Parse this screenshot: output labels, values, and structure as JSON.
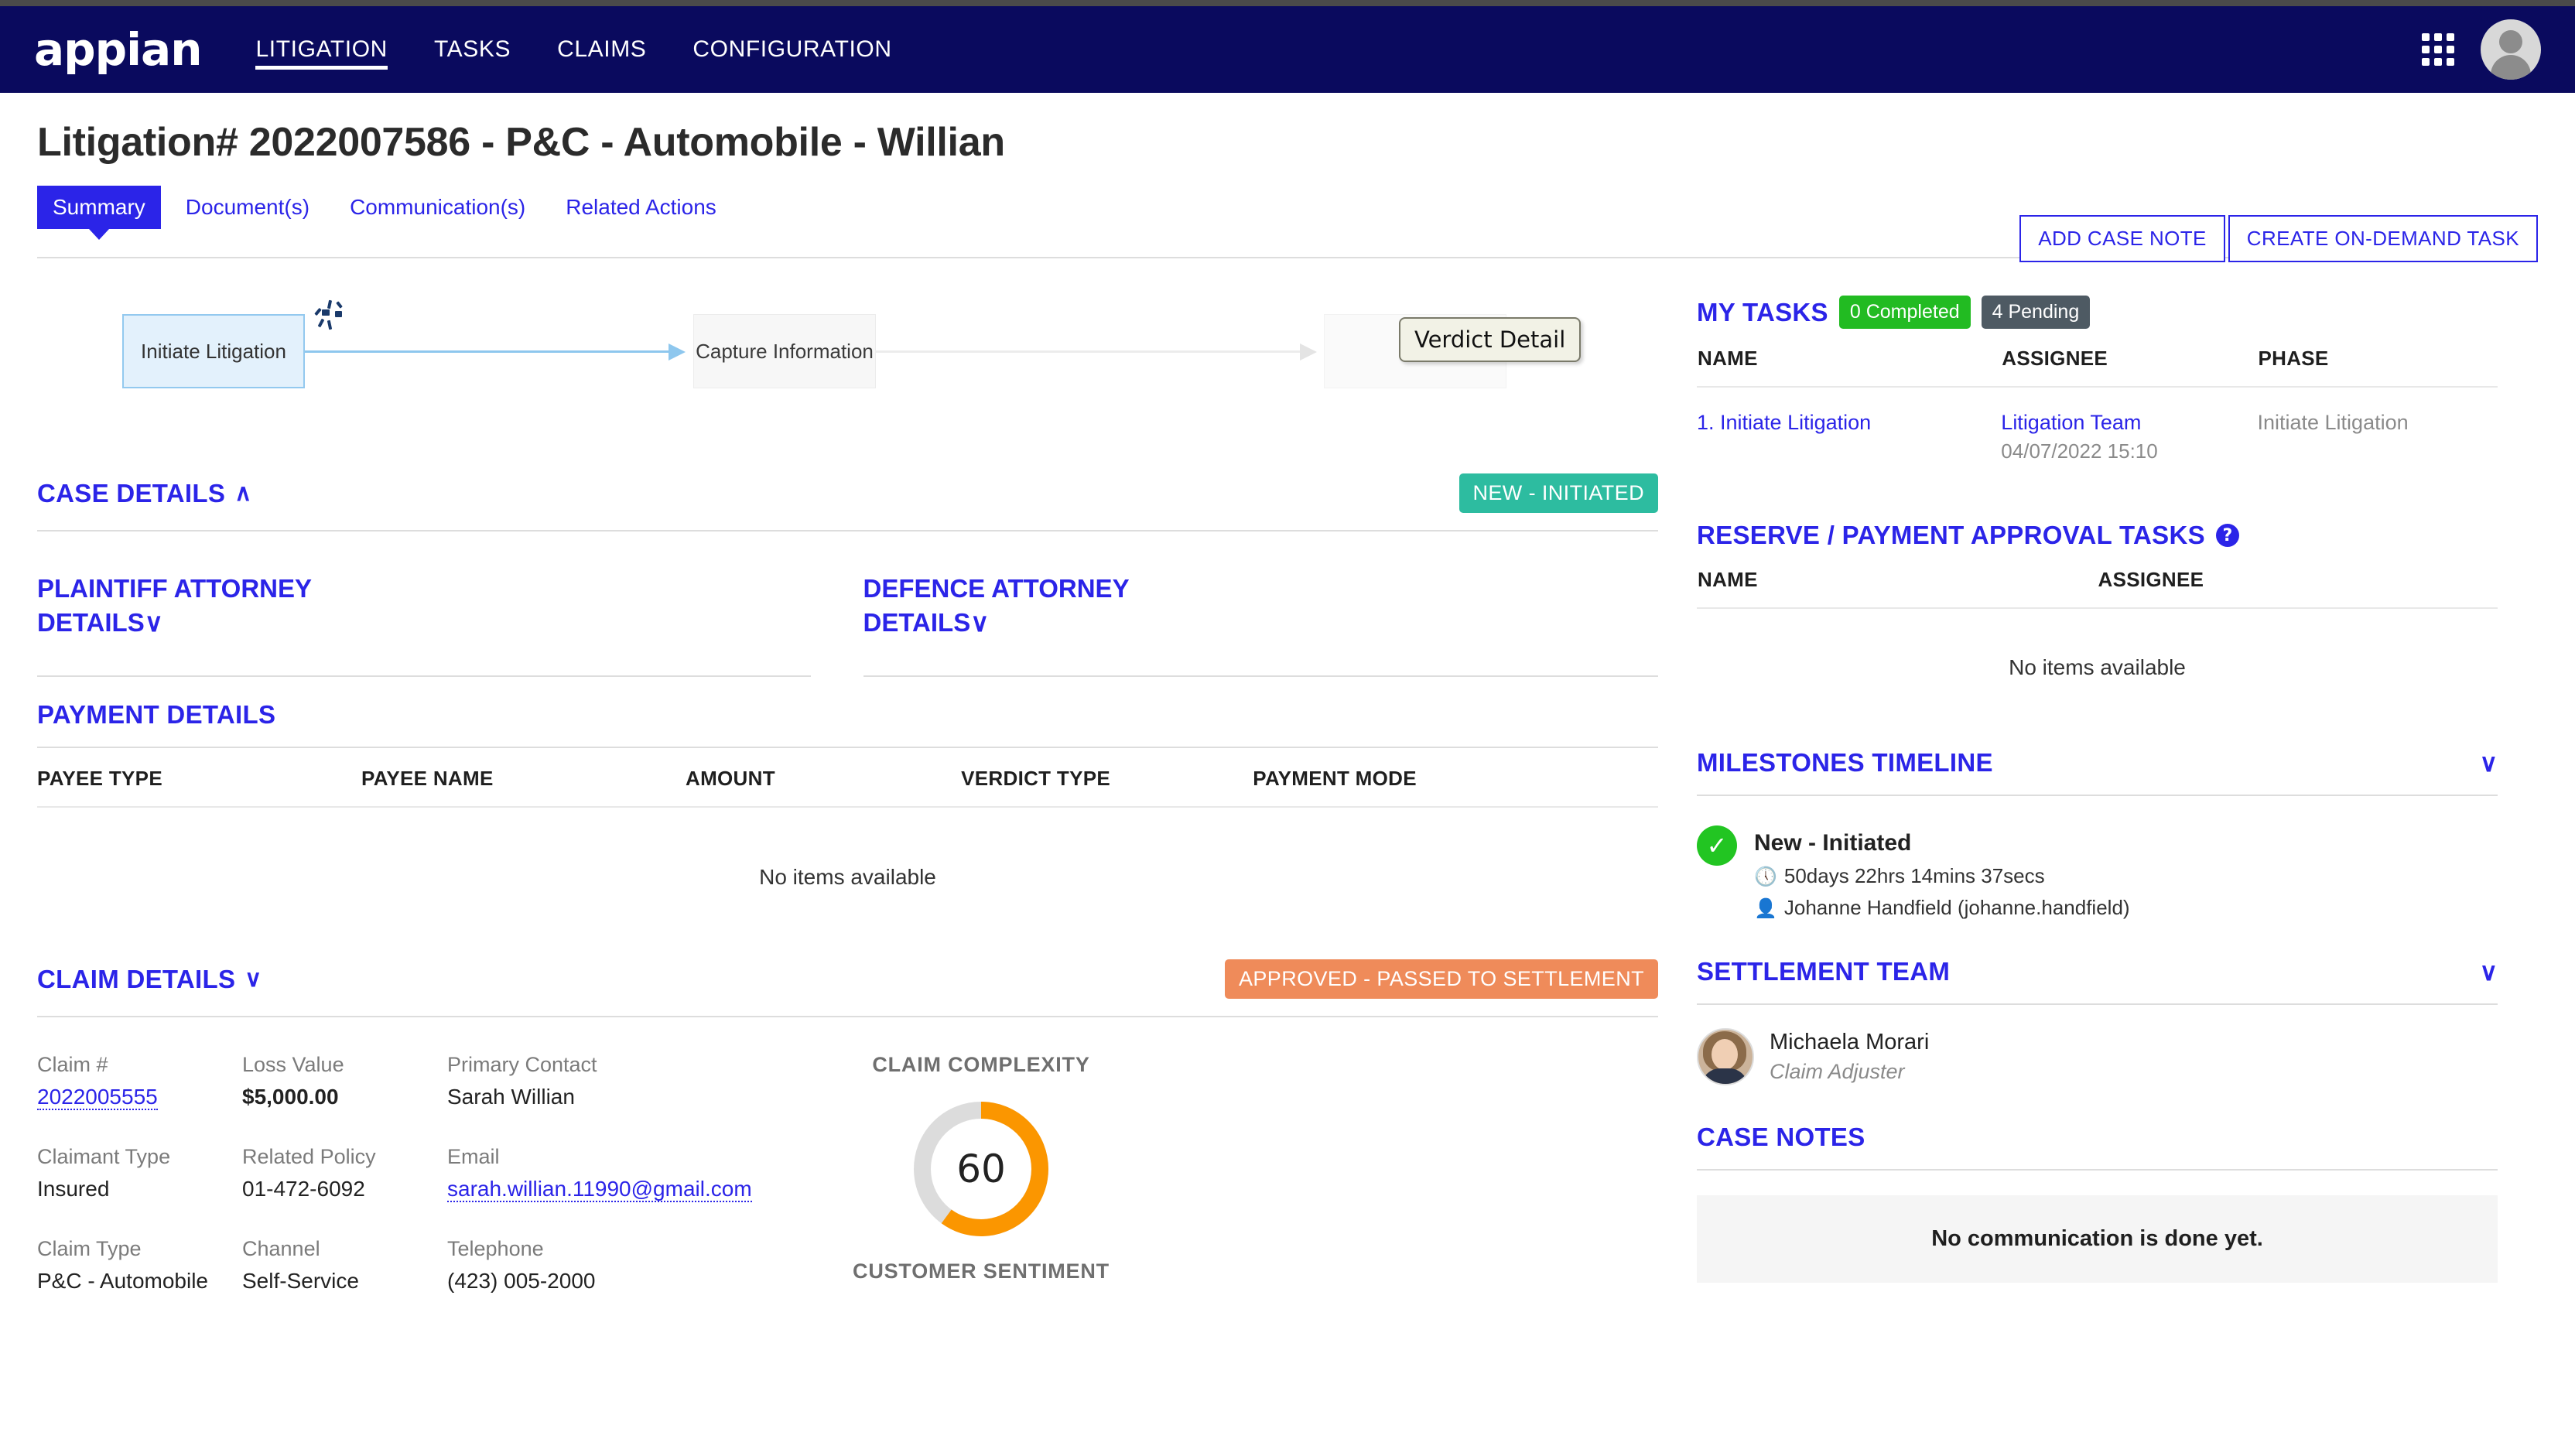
{
  "nav": {
    "logo": "appian",
    "items": [
      {
        "label": "LITIGATION",
        "active": true
      },
      {
        "label": "TASKS",
        "active": false
      },
      {
        "label": "CLAIMS",
        "active": false
      },
      {
        "label": "CONFIGURATION",
        "active": false
      }
    ],
    "apps_icon": "grid-apps-icon",
    "avatar_icon": "user-avatar-icon"
  },
  "header": {
    "title": "Litigation# 2022007586 - P&C - Automobile - Willian",
    "actions": [
      {
        "label": "ADD CASE NOTE"
      },
      {
        "label": "CREATE ON-DEMAND TASK"
      }
    ]
  },
  "tabs": [
    {
      "label": "Summary",
      "active": true
    },
    {
      "label": "Document(s)",
      "active": false
    },
    {
      "label": "Communication(s)",
      "active": false
    },
    {
      "label": "Related Actions",
      "active": false
    }
  ],
  "flow": {
    "nodes": [
      {
        "label": "Initiate Litigation",
        "state": "current"
      },
      {
        "label": "Capture Information",
        "state": "next"
      },
      {
        "label": "Ve",
        "state": "third"
      }
    ],
    "tooltip": "Verdict Detail",
    "spinner": "loading-spinner-icon"
  },
  "case_details": {
    "title": "CASE  DETAILS",
    "chevron": "∧",
    "status_badge": "NEW - INITIATED",
    "status_color": "#2dbca0"
  },
  "plaintiff_attorney": {
    "title": "PLAINTIFF ATTORNEY DETAILS",
    "chevron": "∨"
  },
  "defence_attorney": {
    "title": "DEFENCE ATTORNEY DETAILS",
    "chevron": "∨"
  },
  "payment_details": {
    "title": "PAYMENT DETAILS",
    "columns": [
      "PAYEE TYPE",
      "PAYEE NAME",
      "AMOUNT",
      "VERDICT TYPE",
      "PAYMENT MODE"
    ],
    "rows": [],
    "empty_text": "No items available"
  },
  "claim_details": {
    "title": "CLAIM DETAILS",
    "chevron": "∨",
    "status_badge": "APPROVED - PASSED TO SETTLEMENT",
    "status_color": "#ef8b5a",
    "fields": {
      "claim_no_label": "Claim #",
      "claim_no_value": "2022005555",
      "claimant_type_label": "Claimant Type",
      "claimant_type_value": "Insured",
      "claim_type_label": "Claim Type",
      "claim_type_value": "P&C - Automobile",
      "loss_value_label": "Loss Value",
      "loss_value_value": "$5,000.00",
      "related_policy_label": "Related Policy",
      "related_policy_value": "01-472-6092",
      "channel_label": "Channel",
      "channel_value": "Self-Service",
      "primary_contact_label": "Primary Contact",
      "primary_contact_value": "Sarah Willian",
      "email_label": "Email",
      "email_value": "sarah.willian.11990@gmail.com",
      "telephone_label": "Telephone",
      "telephone_value": "(423) 005-2000"
    }
  },
  "gauge": {
    "top_caption": "CLAIM COMPLEXITY",
    "value": "60",
    "bottom_caption": "CUSTOMER SENTIMENT",
    "percent": 60,
    "arc_color": "#fb9600",
    "track_color": "#dcdcdc"
  },
  "my_tasks": {
    "title": "MY TASKS",
    "completed_chip": "0 Completed",
    "pending_chip": "4 Pending",
    "columns": [
      "NAME",
      "ASSIGNEE",
      "PHASE"
    ],
    "rows": [
      {
        "name": "1. Initiate Litigation",
        "assignee": "Litigation Team",
        "assignee_date": "04/07/2022 15:10",
        "phase": "Initiate Litigation"
      }
    ]
  },
  "reserve_tasks": {
    "title": "RESERVE / PAYMENT APPROVAL TASKS",
    "help_icon": "help-question-icon",
    "columns": [
      "NAME",
      "ASSIGNEE"
    ],
    "rows": [],
    "empty_text": "No items available"
  },
  "milestones": {
    "title": "MILESTONES TIMELINE",
    "chevron": "∨",
    "items": [
      {
        "status_icon": "check-circle-icon",
        "label": "New - Initiated",
        "duration_icon": "clock-icon",
        "duration": "50days 22hrs 14mins 37secs",
        "person_icon": "person-icon",
        "person": "Johanne Handfield (johanne.handfield)"
      }
    ]
  },
  "settlement_team": {
    "title": "SETTLEMENT TEAM",
    "chevron": "∨",
    "members": [
      {
        "name": "Michaela Morari",
        "role": "Claim Adjuster",
        "avatar": "member-photo-icon"
      }
    ]
  },
  "case_notes": {
    "title": "CASE NOTES",
    "empty_text": "No communication is done yet."
  }
}
